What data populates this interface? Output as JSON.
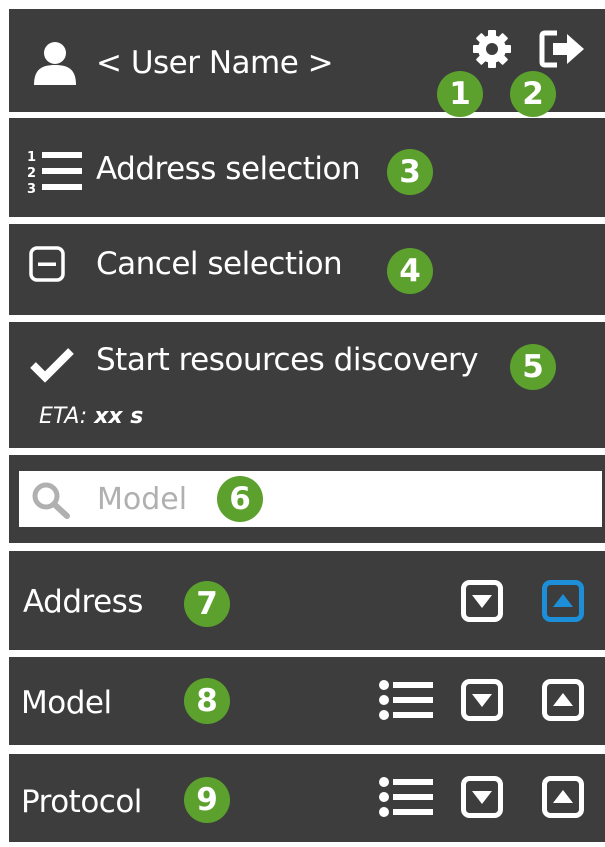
{
  "header": {
    "user_name": "< User Name >",
    "settings_badge": "1",
    "logout_badge": "2"
  },
  "address_selection": {
    "label": "Address selection",
    "badge": "3"
  },
  "cancel_selection": {
    "label": "Cancel selection",
    "badge": "4"
  },
  "start_discovery": {
    "label": "Start resources discovery",
    "badge": "5",
    "eta_label": "ETA:",
    "eta_value": "xx s"
  },
  "search": {
    "placeholder": "Model",
    "value": "",
    "badge": "6"
  },
  "columns": [
    {
      "label": "Address",
      "badge": "7",
      "has_list": false,
      "sort_up_active": true
    },
    {
      "label": "Model",
      "badge": "8",
      "has_list": true,
      "sort_up_active": false
    },
    {
      "label": "Protocol",
      "badge": "9",
      "has_list": true,
      "sort_up_active": false
    }
  ],
  "colors": {
    "panel_bg": "#3d3d3d",
    "badge_green": "#5ca12e",
    "active_blue": "#1c8fd8",
    "text": "#ffffff",
    "placeholder": "#b0b0b0"
  },
  "icons": {
    "user": "user-icon",
    "settings": "gear-icon",
    "logout": "logout-icon",
    "numbered_list": "numbered-list-icon",
    "cancel": "minus-box-icon",
    "check": "checkmark-icon",
    "search": "search-icon",
    "list": "list-icon",
    "sort_down": "sort-down-icon",
    "sort_up": "sort-up-icon"
  }
}
